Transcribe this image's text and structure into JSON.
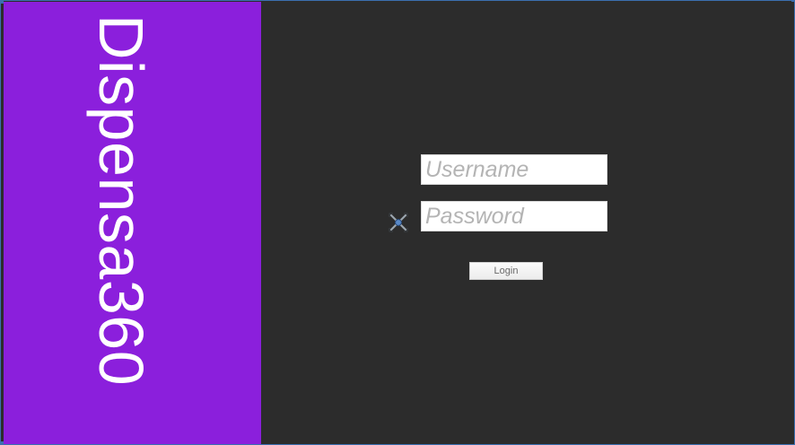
{
  "brand": {
    "title": "Dispensa360"
  },
  "login_form": {
    "username_placeholder": "Username",
    "password_placeholder": "Password",
    "login_label": "Login",
    "move_icon": "move-cross-icon"
  },
  "colors": {
    "brand_panel": "#8b1fdc",
    "background": "#2c2c2c",
    "window_border": "#3b6fb0"
  }
}
